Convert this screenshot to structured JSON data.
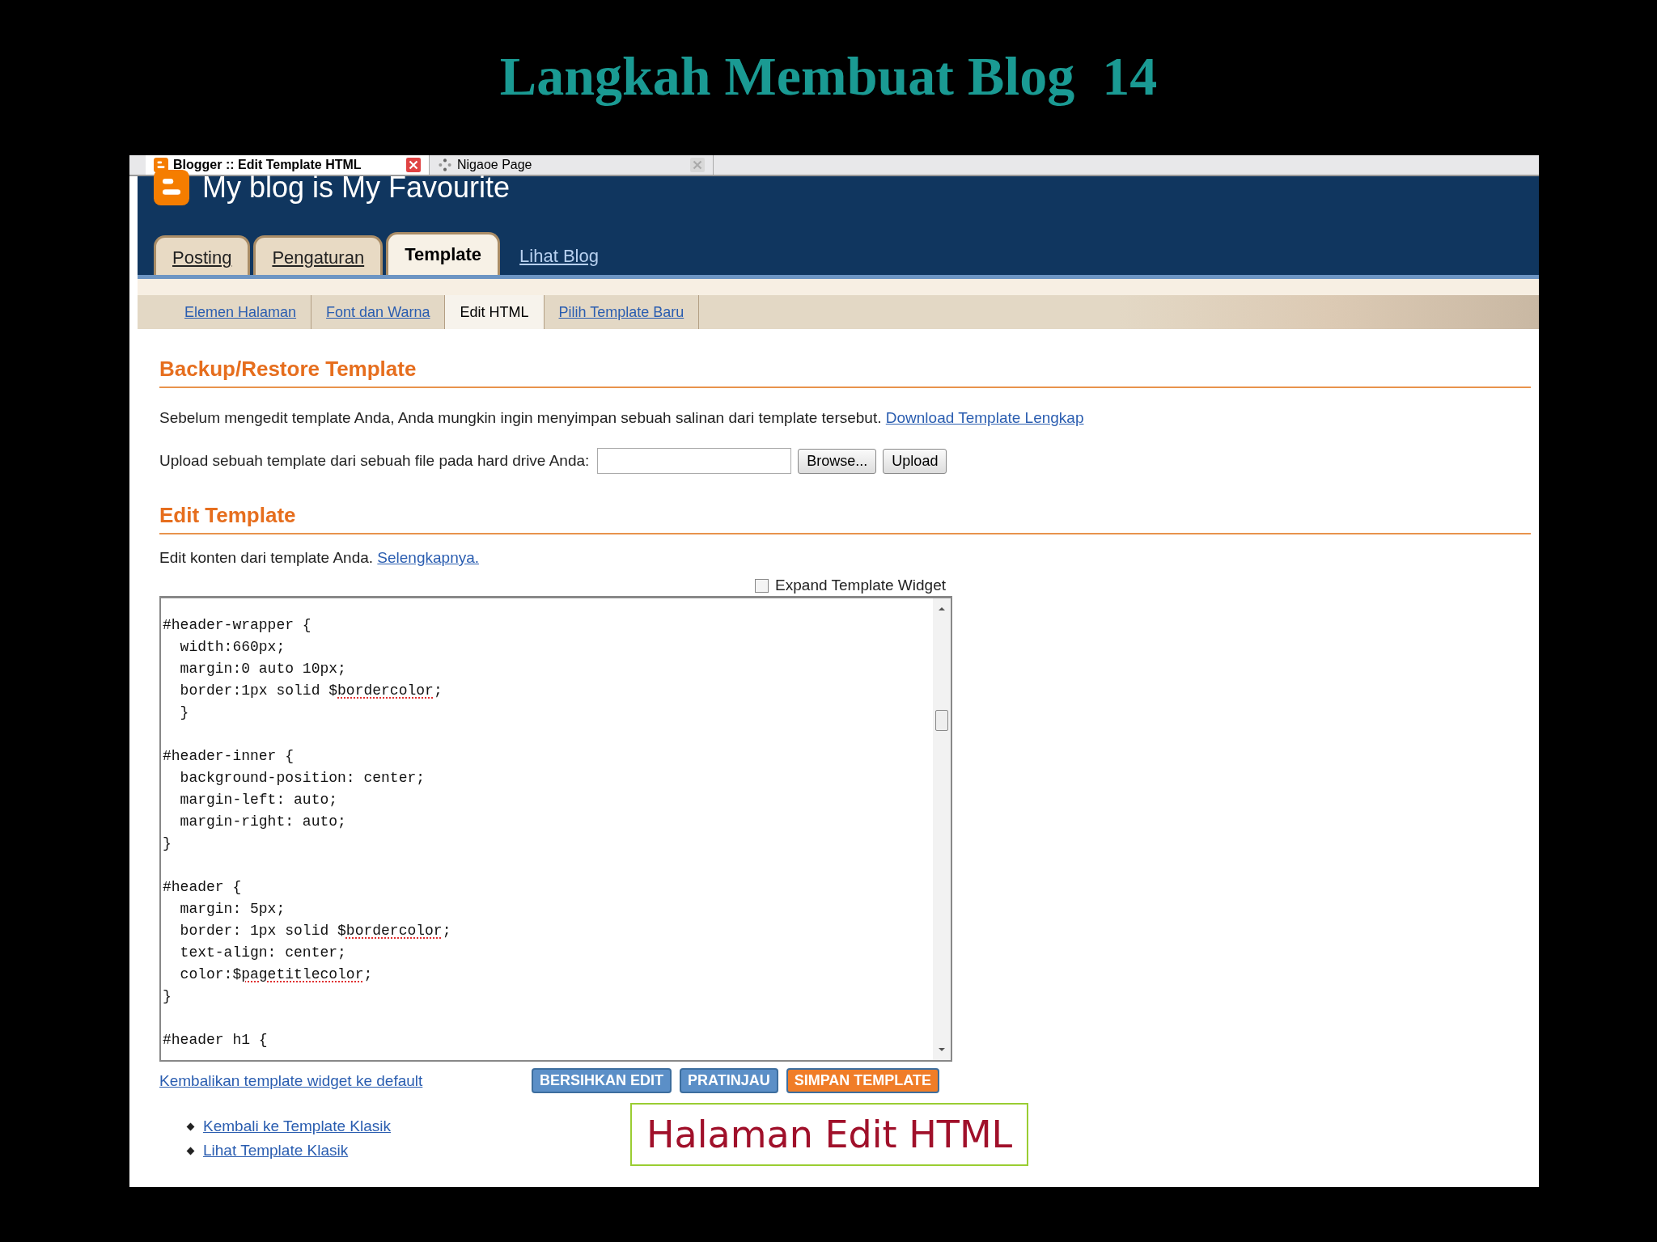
{
  "slide_title": "Langkah Membuat Blog  14",
  "browser_tabs": [
    {
      "title": "Blogger :: Edit Template HTML",
      "selected": true
    },
    {
      "title": "Nigaoe Page",
      "selected": false
    }
  ],
  "blog_title": "My blog is My Favourite",
  "main_tabs": [
    {
      "label": "Posting",
      "kind": "tab",
      "selected": false
    },
    {
      "label": "Pengaturan",
      "kind": "tab",
      "selected": false
    },
    {
      "label": "Template",
      "kind": "tab",
      "selected": true
    },
    {
      "label": "Lihat Blog",
      "kind": "link",
      "selected": false
    }
  ],
  "sub_tabs": [
    {
      "label": "Elemen Halaman",
      "selected": false
    },
    {
      "label": "Font dan Warna",
      "selected": false
    },
    {
      "label": "Edit HTML",
      "selected": true
    },
    {
      "label": "Pilih Template Baru",
      "selected": false
    }
  ],
  "backup": {
    "heading": "Backup/Restore Template",
    "description": "Sebelum mengedit template Anda, Anda mungkin ingin menyimpan sebuah salinan dari template tersebut.",
    "download_link": "Download Template Lengkap",
    "upload_label": "Upload sebuah template dari sebuah file pada hard drive Anda:",
    "browse_button": "Browse...",
    "upload_button": "Upload"
  },
  "edit": {
    "heading": "Edit Template",
    "description": "Edit konten dari template Anda.",
    "more_link": "Selengkapnya.",
    "expand_widget": {
      "label": "Expand Template Widget",
      "checked": false
    },
    "code_blocks": [
      {
        "lines": [
          [
            {
              "text": "#header-wrapper {",
              "misspelled": false
            }
          ],
          [
            {
              "text": "  width:660px;",
              "misspelled": false
            }
          ],
          [
            {
              "text": "  margin:0 auto 10px;",
              "misspelled": false
            }
          ],
          [
            {
              "text": "  border:1px solid $",
              "misspelled": false
            },
            {
              "text": "bordercolor",
              "misspelled": true
            },
            {
              "text": ";",
              "misspelled": false
            }
          ],
          [
            {
              "text": "  }",
              "misspelled": false
            }
          ]
        ]
      },
      {
        "lines": [
          [
            {
              "text": "#header-inner {",
              "misspelled": false
            }
          ],
          [
            {
              "text": "  background-position: center;",
              "misspelled": false
            }
          ],
          [
            {
              "text": "  margin-left: auto;",
              "misspelled": false
            }
          ],
          [
            {
              "text": "  margin-right: auto;",
              "misspelled": false
            }
          ],
          [
            {
              "text": "}",
              "misspelled": false
            }
          ]
        ]
      },
      {
        "lines": [
          [
            {
              "text": "#header {",
              "misspelled": false
            }
          ],
          [
            {
              "text": "  margin: 5px;",
              "misspelled": false
            }
          ],
          [
            {
              "text": "  border: 1px solid $",
              "misspelled": false
            },
            {
              "text": "bordercolor",
              "misspelled": true
            },
            {
              "text": ";",
              "misspelled": false
            }
          ],
          [
            {
              "text": "  text-align: center;",
              "misspelled": false
            }
          ],
          [
            {
              "text": "  color:$",
              "misspelled": false
            },
            {
              "text": "pagetitlecolor",
              "misspelled": true
            },
            {
              "text": ";",
              "misspelled": false
            }
          ],
          [
            {
              "text": "}",
              "misspelled": false
            }
          ]
        ]
      },
      {
        "lines": [
          [
            {
              "text": "#header h1 {",
              "misspelled": false
            }
          ]
        ]
      }
    ],
    "reset_link": "Kembalikan template widget ke default",
    "buttons": [
      {
        "label": "BERSIHKAN EDIT",
        "color": "#5b8fc7"
      },
      {
        "label": "PRATINJAU",
        "color": "#5b8fc7"
      },
      {
        "label": "SIMPAN TEMPLATE",
        "color": "#f07d28"
      }
    ],
    "links": [
      "Kembali ke Template Klasik",
      "Lihat Template Klasik"
    ]
  },
  "caption": "Halaman Edit HTML"
}
